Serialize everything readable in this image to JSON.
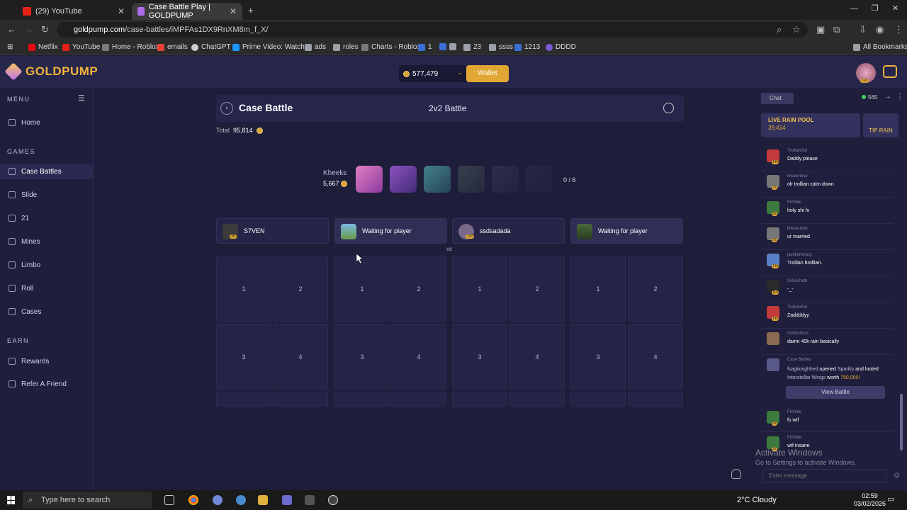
{
  "browser": {
    "tabs": [
      {
        "title": "(29) YouTube"
      },
      {
        "title": "Case Battle Play | GOLDPUMP"
      }
    ],
    "url_host": "goldpump.com",
    "url_path": "/case-battles/iMPFAs1DX9RnXM8m_f_X/",
    "bookmarks": [
      "Netflix",
      "YouTube",
      "Home - Roblox",
      "emails",
      "ChatGPT",
      "Prime Video: Watch...",
      "ads",
      "roles",
      "Charts - Roblox",
      "1",
      "",
      "23",
      "ssss",
      "1213",
      "DDDD"
    ],
    "all_bookmarks": "All Bookmarks"
  },
  "header": {
    "logo": "GOLDPUMP",
    "balance": "577,479",
    "wallet": "Wallet",
    "avatar_level": "118"
  },
  "sidebar": {
    "menu_label": "MENU",
    "games_label": "GAMES",
    "earn_label": "EARN",
    "items": [
      {
        "label": "Home"
      },
      {
        "label": "Case Battles"
      },
      {
        "label": "Slide"
      },
      {
        "label": "21"
      },
      {
        "label": "Mines"
      },
      {
        "label": "Limbo"
      },
      {
        "label": "Roll"
      },
      {
        "label": "Cases"
      },
      {
        "label": "Rewards"
      },
      {
        "label": "Refer A Friend"
      }
    ]
  },
  "battle": {
    "title": "Case Battle",
    "mode": "2v2 Battle",
    "total_label": "Total",
    "total_value": "95,814",
    "case_owner": "Kheeks",
    "case_value": "5,667",
    "progress": "0 / 6",
    "vs": "vs",
    "players": [
      {
        "name": "S7VEN",
        "level": "38"
      },
      {
        "name": "Waiting for player",
        "level": ""
      },
      {
        "name": "ssdsadada",
        "level": "118"
      },
      {
        "name": "Waiting for player",
        "level": ""
      }
    ],
    "slot_labels": [
      "1",
      "2",
      "3",
      "4"
    ]
  },
  "chat": {
    "tab": "Chat",
    "online": "565",
    "rain_title": "LIVE RAIN POOL",
    "rain_value": "39,414",
    "tip_rain": "TIP RAIN",
    "messages": [
      {
        "user": "TrollianSol",
        "level": "146",
        "text": "Daddy please"
      },
      {
        "user": "ilneverlose",
        "level": "72",
        "text": "olr trollian calm down"
      },
      {
        "user": "FriVolle",
        "level": "59",
        "text": "holy shi fs"
      },
      {
        "user": "ilneverlose",
        "level": "72",
        "text": "ur married"
      },
      {
        "user": "jackkerbeazy",
        "level": "120",
        "text": "Trollian brollian."
      },
      {
        "user": "3xSochetti",
        "level": "114",
        "text": "-_-"
      },
      {
        "user": "TrollianSol",
        "level": "146",
        "text": "Zaddddyy"
      },
      {
        "user": "confectmss",
        "level": "",
        "text": "damn 40k rain basically"
      }
    ],
    "system": {
      "user": "Case Battles",
      "name": "fsagkosghhed",
      "opened": "opened",
      "case": "Sparkly",
      "and_looted": "and looted",
      "item": "Interstellar Wings",
      "worth": "worth",
      "value": "750,000!",
      "view_battle": "View Battle"
    },
    "messages2": [
      {
        "user": "FriVolle",
        "level": "59",
        "text": "fs wtf"
      },
      {
        "user": "FriVolle",
        "level": "59",
        "text": "wtf insane"
      }
    ],
    "input_placeholder": "Enter message"
  },
  "windows": {
    "activate": "Activate Windows",
    "activate_sub": "Go to Settings to activate Windows.",
    "search_placeholder": "Type here to search",
    "weather": "2°C  Cloudy",
    "time": "02:59",
    "date": "03/02/2026"
  },
  "colors": {
    "accent": "#e0a734",
    "background": "#1e1d3a",
    "panel": "#26254a"
  }
}
